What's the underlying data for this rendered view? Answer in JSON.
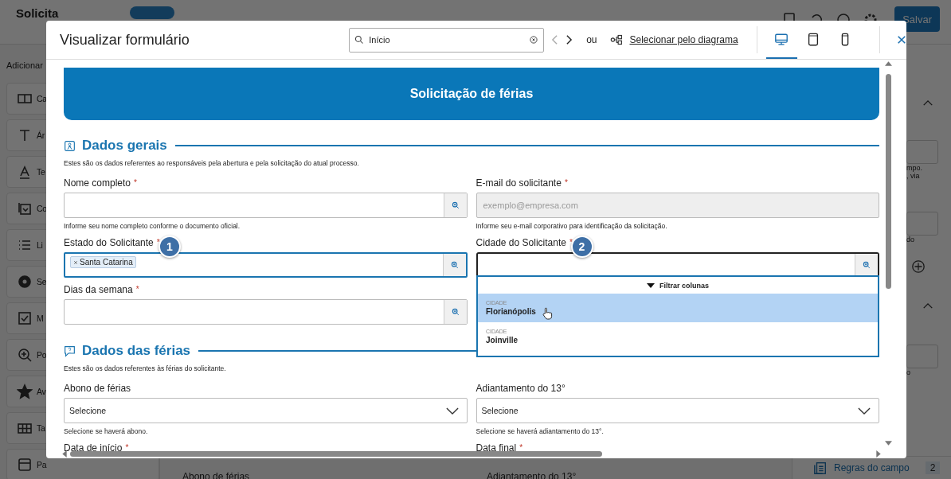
{
  "background": {
    "title": "Solicita",
    "save_button": "Salvar",
    "sidebar_heading": "Adicionar",
    "sidebar_items": [
      {
        "kind": "field",
        "label": "Ca"
      },
      {
        "kind": "text",
        "label": "Ár"
      },
      {
        "kind": "label",
        "label": "Te"
      },
      {
        "kind": "dropdown",
        "label": "Co"
      },
      {
        "kind": "list",
        "label": "Li"
      },
      {
        "kind": "radio",
        "label": "Se"
      },
      {
        "kind": "checkbox",
        "label": "M"
      },
      {
        "kind": "zoom",
        "label": "Po"
      },
      {
        "kind": "star",
        "label": "Av"
      },
      {
        "kind": "table",
        "label": "Ta"
      },
      {
        "kind": "panel",
        "label": "Pa"
      }
    ],
    "panel_texts": [
      "mpo.",
      ", via",
      "do",
      "o"
    ],
    "rules": {
      "label": "Regras do campo",
      "count": "2"
    },
    "main_labels": [
      "Abono de férias",
      "Adiantamento do 13°"
    ]
  },
  "modal": {
    "title": "Visualizar formulário",
    "search": {
      "value": "Início"
    },
    "nav": [
      {
        "kind": "prev",
        "disabled": true
      },
      {
        "kind": "next",
        "disabled": false
      }
    ],
    "or_label": "ou",
    "diagram_link": "Selecionar pelo diagrama",
    "devices": [
      {
        "kind": "desktop",
        "selected": true
      },
      {
        "kind": "tablet",
        "selected": false
      },
      {
        "kind": "mobile",
        "selected": false
      }
    ],
    "form": {
      "banner": "Solicitação de férias",
      "sections": [
        {
          "kind": "person",
          "title": "Dados gerais",
          "description": "Estes são os dados referentes ao responsáveis pela abertura e pela solicitação do atual processo.",
          "fields": [
            {
              "kind": "lookup",
              "label": "Nome completo",
              "required_mark": "*",
              "hint": "Informe seu nome completo conforme o documento oficial."
            },
            {
              "kind": "text",
              "label": "E-mail do solicitante",
              "required_mark": "*",
              "placeholder": "exemplo@empresa.com",
              "disabled": true,
              "hint": "Informe seu e-mail corporativo para identificação da solicitação."
            },
            {
              "kind": "lookup",
              "label": "Estado do Solicitante",
              "required_mark": "*",
              "tags": [
                "Santa Catarina"
              ],
              "focused": true,
              "callout": "1"
            },
            {
              "kind": "lookup",
              "label": "Cidade do Solicitante",
              "required_mark": "*",
              "open": true,
              "callout": "2"
            },
            {
              "kind": "lookup",
              "label": "Dias da semana",
              "required_mark": "*"
            }
          ]
        },
        {
          "kind": "question",
          "title": "Dados das férias",
          "description": "Estes são os dados referentes às férias do solicitante.",
          "fields": [
            {
              "kind": "select",
              "label": "Abono de férias",
              "value": "Selecione",
              "hint": "Selecione se haverá abono."
            },
            {
              "kind": "select",
              "label": "Adiantamento do 13°",
              "value": "Selecione",
              "hint": "Selecione se haverá adiantamento do 13°."
            },
            {
              "kind": "date",
              "label": "Data de início",
              "required_mark": "*"
            },
            {
              "kind": "date",
              "label": "Data final",
              "required_mark": "*"
            }
          ]
        }
      ]
    },
    "dropdown": {
      "filter_label": "Filtrar colunas",
      "options": [
        {
          "column": "CIDADE",
          "value": "Florianópolis",
          "selected": true
        },
        {
          "column": "CIDADE",
          "value": "Joinville",
          "selected": false
        }
      ]
    }
  }
}
